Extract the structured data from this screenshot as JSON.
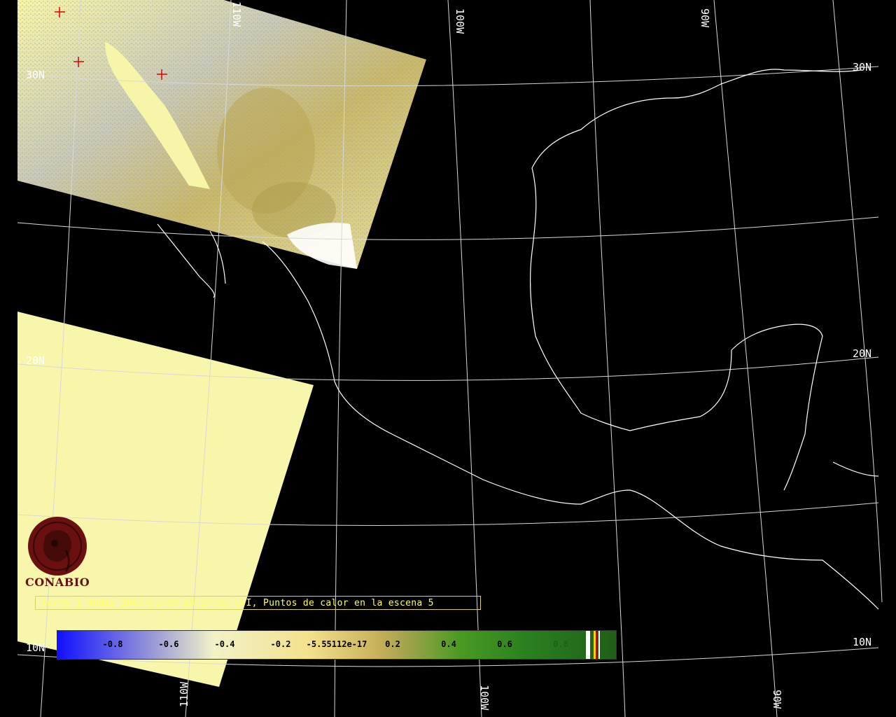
{
  "map": {
    "grid_labels": {
      "lat_30n_left": "30N",
      "lat_30n_right": "30N",
      "lat_20n_left": "20N",
      "lat_20n_right": "20N",
      "lat_10n_left": "10N",
      "lat_10n_right": "10N",
      "lon_100w_top": "100W",
      "lon_90w_top": "90W",
      "lon_110w_top": "110W",
      "lon_110w_bottom": "110W",
      "lon_100w_bottom": "100W",
      "lon_90w_bottom": "90W"
    },
    "hotspot_marker": "red-cross",
    "land_color_low": "#f6f5a8",
    "coast_color": "#ffffff"
  },
  "caption": "terra-1 modis 2007/01/08 18:27:21 EVI, Puntos de calor en la escena 5",
  "colorbar": {
    "ticks": [
      "-0.8",
      "-0.6",
      "-0.4",
      "-0.2",
      "-5.55112e-17",
      "0.2",
      "0.4",
      "0.6",
      "0.8"
    ],
    "low_color": "#1010ff",
    "high_color": "#1f5f18"
  },
  "logo": {
    "text": "CONABIO",
    "color": "#6b1010"
  }
}
